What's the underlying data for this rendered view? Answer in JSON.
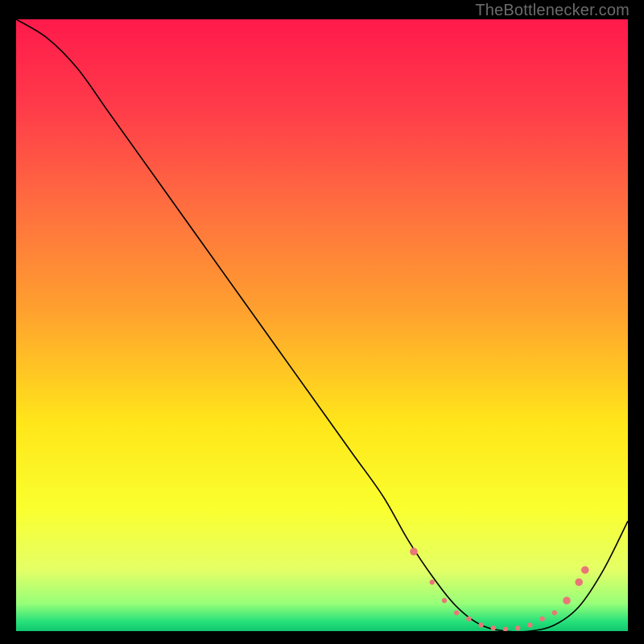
{
  "attribution": "TheBottlenecker.com",
  "chart_data": {
    "type": "line",
    "title": "",
    "xlabel": "",
    "ylabel": "",
    "xlim": [
      0,
      100
    ],
    "ylim": [
      0,
      100
    ],
    "grid": false,
    "legend": false,
    "series": [
      {
        "name": "bottleneck-curve",
        "x": [
          0,
          5,
          10,
          15,
          20,
          25,
          30,
          35,
          40,
          45,
          50,
          55,
          60,
          64,
          68,
          72,
          76,
          80,
          84,
          88,
          92,
          96,
          100
        ],
        "y": [
          100,
          97,
          92,
          85,
          78,
          71,
          64,
          57,
          50,
          43,
          36,
          29,
          22,
          15,
          9,
          4,
          1,
          0,
          0,
          1,
          4,
          10,
          18
        ],
        "stroke": "#000000",
        "width": 1.6
      }
    ],
    "markers": {
      "name": "highlight-dots",
      "color": "#e97777",
      "radius_small": 3.2,
      "radius_large": 4.8,
      "points": [
        {
          "x": 65,
          "y": 13,
          "r": "large"
        },
        {
          "x": 68,
          "y": 8,
          "r": "small"
        },
        {
          "x": 70,
          "y": 5,
          "r": "small"
        },
        {
          "x": 72,
          "y": 3,
          "r": "small"
        },
        {
          "x": 74,
          "y": 2,
          "r": "small"
        },
        {
          "x": 76,
          "y": 1,
          "r": "small"
        },
        {
          "x": 78,
          "y": 0.5,
          "r": "small"
        },
        {
          "x": 80,
          "y": 0.3,
          "r": "small"
        },
        {
          "x": 82,
          "y": 0.5,
          "r": "small"
        },
        {
          "x": 84,
          "y": 1,
          "r": "small"
        },
        {
          "x": 86,
          "y": 2,
          "r": "small"
        },
        {
          "x": 88,
          "y": 3,
          "r": "small"
        },
        {
          "x": 90,
          "y": 5,
          "r": "large"
        },
        {
          "x": 92,
          "y": 8,
          "r": "large"
        },
        {
          "x": 93,
          "y": 10,
          "r": "large"
        }
      ]
    },
    "background_gradient": {
      "stops": [
        {
          "offset": 0.0,
          "color": "#ff1a4b"
        },
        {
          "offset": 0.14,
          "color": "#ff3a4a"
        },
        {
          "offset": 0.3,
          "color": "#ff6c40"
        },
        {
          "offset": 0.48,
          "color": "#ffa22e"
        },
        {
          "offset": 0.66,
          "color": "#ffe61a"
        },
        {
          "offset": 0.8,
          "color": "#faff2e"
        },
        {
          "offset": 0.9,
          "color": "#e4ff66"
        },
        {
          "offset": 0.955,
          "color": "#97ff79"
        },
        {
          "offset": 0.985,
          "color": "#25e07a"
        },
        {
          "offset": 1.0,
          "color": "#11c66f"
        }
      ]
    }
  }
}
